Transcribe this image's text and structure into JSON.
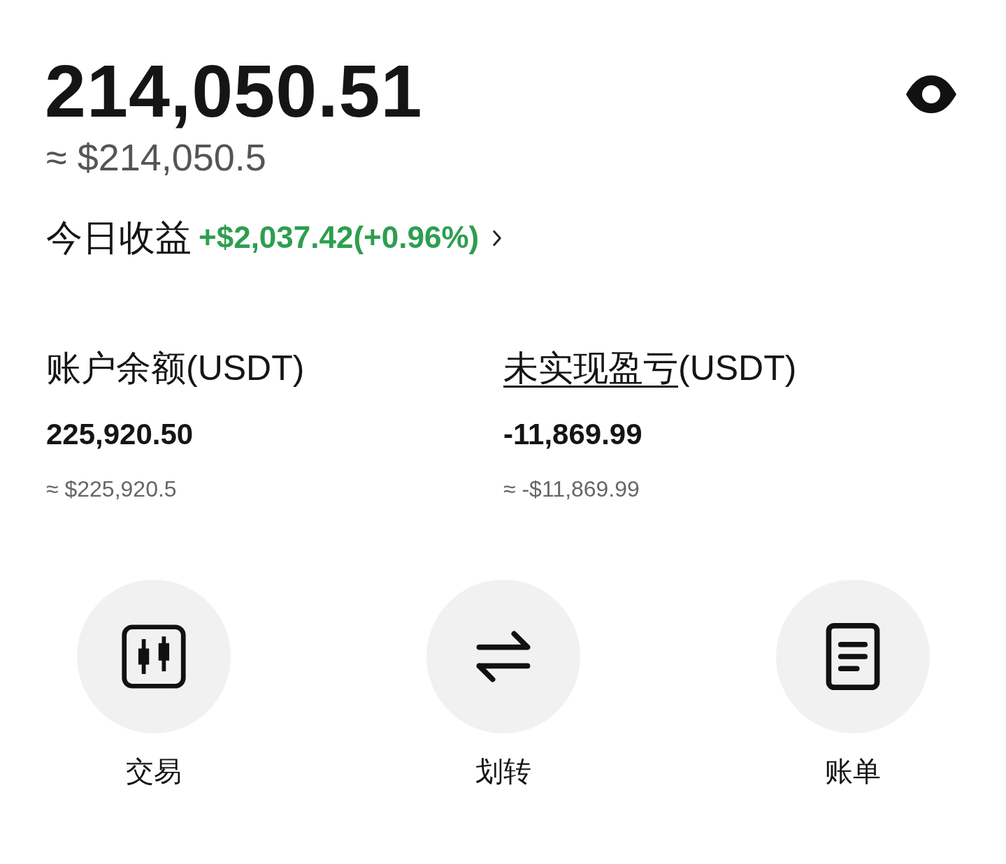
{
  "total": {
    "value": "214,050.51",
    "approx": "≈ $214,050.5"
  },
  "today_pnl": {
    "label": "今日收益",
    "value": "+$2,037.42(+0.96%)"
  },
  "stats": [
    {
      "label": "账户余额",
      "unit": "(USDT)",
      "underlined": false,
      "value": "225,920.50",
      "approx": "≈ $225,920.5"
    },
    {
      "label": "未实现盈亏",
      "unit": "(USDT)",
      "underlined": true,
      "value": "-11,869.99",
      "approx": "≈ -$11,869.99"
    }
  ],
  "actions": [
    {
      "kind": "trade",
      "label": "交易"
    },
    {
      "kind": "transfer",
      "label": "划转"
    },
    {
      "kind": "bill",
      "label": "账单"
    }
  ]
}
